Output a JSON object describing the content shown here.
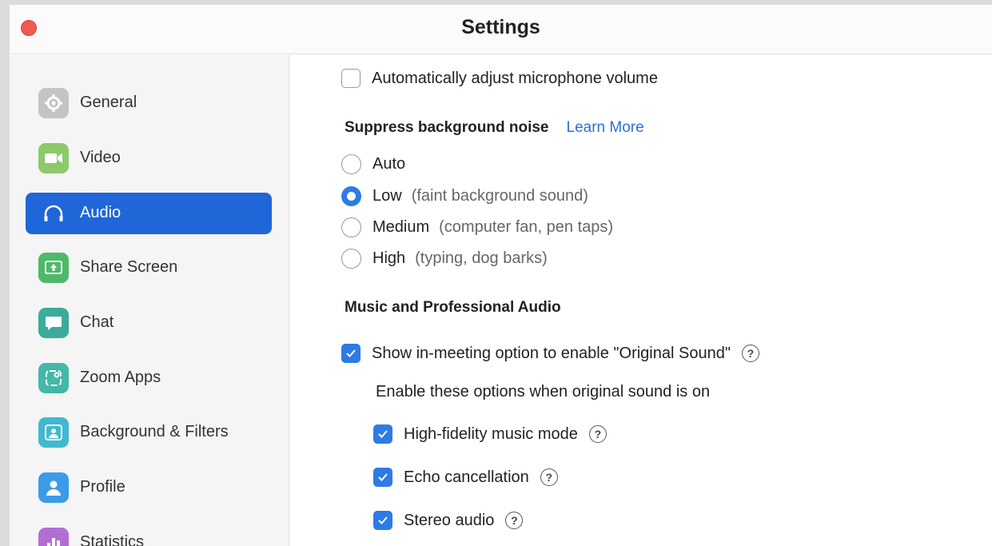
{
  "window": {
    "title": "Settings"
  },
  "colors": {
    "accent": "#1f66d8",
    "checkbox": "#2d7be5",
    "close": "#ee5a52"
  },
  "sidebar": {
    "items": [
      {
        "label": "General",
        "icon": "gear-icon",
        "color": "#bdbdbd"
      },
      {
        "label": "Video",
        "icon": "video-camera-icon",
        "color": "#8cc96c"
      },
      {
        "label": "Audio",
        "icon": "headphones-icon",
        "color": "#1f66d8",
        "active": true
      },
      {
        "label": "Share Screen",
        "icon": "share-screen-icon",
        "color": "#4fb86a"
      },
      {
        "label": "Chat",
        "icon": "chat-bubble-icon",
        "color": "#3bab9b"
      },
      {
        "label": "Zoom Apps",
        "icon": "apps-icon",
        "color": "#43b8a8"
      },
      {
        "label": "Background & Filters",
        "icon": "background-person-icon",
        "color": "#42b8d0"
      },
      {
        "label": "Profile",
        "icon": "profile-person-icon",
        "color": "#3b9be8"
      },
      {
        "label": "Statistics",
        "icon": "bar-chart-icon",
        "color": "#b26fd3"
      }
    ]
  },
  "audio": {
    "auto_adjust_label": "Automatically adjust microphone volume",
    "auto_adjust_checked": false,
    "suppress_title": "Suppress background noise",
    "learn_more": "Learn More",
    "suppress_options": [
      {
        "label": "Auto",
        "hint": "",
        "selected": false
      },
      {
        "label": "Low",
        "hint": "(faint background sound)",
        "selected": true
      },
      {
        "label": "Medium",
        "hint": "(computer fan, pen taps)",
        "selected": false
      },
      {
        "label": "High",
        "hint": "(typing, dog barks)",
        "selected": false
      }
    ],
    "music_title": "Music and Professional Audio",
    "original_sound_label": "Show in-meeting option to enable \"Original Sound\"",
    "original_sound_checked": true,
    "enable_options_text": "Enable these options when original sound is on",
    "sub_options": [
      {
        "label": "High-fidelity music mode",
        "checked": true
      },
      {
        "label": "Echo cancellation",
        "checked": true
      },
      {
        "label": "Stereo audio",
        "checked": true
      }
    ],
    "help_glyph": "?"
  }
}
